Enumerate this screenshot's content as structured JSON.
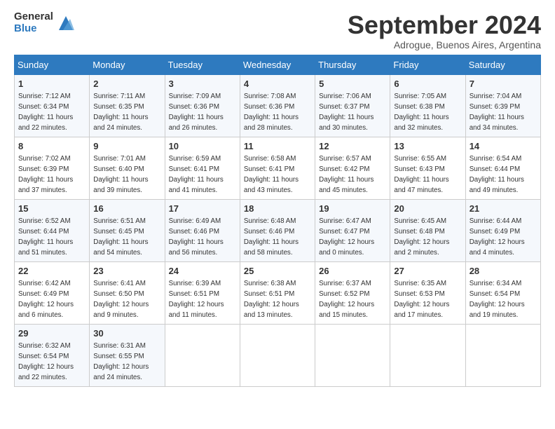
{
  "logo": {
    "general": "General",
    "blue": "Blue"
  },
  "title": "September 2024",
  "subtitle": "Adrogue, Buenos Aires, Argentina",
  "days": [
    "Sunday",
    "Monday",
    "Tuesday",
    "Wednesday",
    "Thursday",
    "Friday",
    "Saturday"
  ],
  "weeks": [
    [
      {
        "num": "1",
        "sunrise": "7:12 AM",
        "sunset": "6:34 PM",
        "daylight": "11 hours and 22 minutes."
      },
      {
        "num": "2",
        "sunrise": "7:11 AM",
        "sunset": "6:35 PM",
        "daylight": "11 hours and 24 minutes."
      },
      {
        "num": "3",
        "sunrise": "7:09 AM",
        "sunset": "6:36 PM",
        "daylight": "11 hours and 26 minutes."
      },
      {
        "num": "4",
        "sunrise": "7:08 AM",
        "sunset": "6:36 PM",
        "daylight": "11 hours and 28 minutes."
      },
      {
        "num": "5",
        "sunrise": "7:06 AM",
        "sunset": "6:37 PM",
        "daylight": "11 hours and 30 minutes."
      },
      {
        "num": "6",
        "sunrise": "7:05 AM",
        "sunset": "6:38 PM",
        "daylight": "11 hours and 32 minutes."
      },
      {
        "num": "7",
        "sunrise": "7:04 AM",
        "sunset": "6:39 PM",
        "daylight": "11 hours and 34 minutes."
      }
    ],
    [
      {
        "num": "8",
        "sunrise": "7:02 AM",
        "sunset": "6:39 PM",
        "daylight": "11 hours and 37 minutes."
      },
      {
        "num": "9",
        "sunrise": "7:01 AM",
        "sunset": "6:40 PM",
        "daylight": "11 hours and 39 minutes."
      },
      {
        "num": "10",
        "sunrise": "6:59 AM",
        "sunset": "6:41 PM",
        "daylight": "11 hours and 41 minutes."
      },
      {
        "num": "11",
        "sunrise": "6:58 AM",
        "sunset": "6:41 PM",
        "daylight": "11 hours and 43 minutes."
      },
      {
        "num": "12",
        "sunrise": "6:57 AM",
        "sunset": "6:42 PM",
        "daylight": "11 hours and 45 minutes."
      },
      {
        "num": "13",
        "sunrise": "6:55 AM",
        "sunset": "6:43 PM",
        "daylight": "11 hours and 47 minutes."
      },
      {
        "num": "14",
        "sunrise": "6:54 AM",
        "sunset": "6:44 PM",
        "daylight": "11 hours and 49 minutes."
      }
    ],
    [
      {
        "num": "15",
        "sunrise": "6:52 AM",
        "sunset": "6:44 PM",
        "daylight": "11 hours and 51 minutes."
      },
      {
        "num": "16",
        "sunrise": "6:51 AM",
        "sunset": "6:45 PM",
        "daylight": "11 hours and 54 minutes."
      },
      {
        "num": "17",
        "sunrise": "6:49 AM",
        "sunset": "6:46 PM",
        "daylight": "11 hours and 56 minutes."
      },
      {
        "num": "18",
        "sunrise": "6:48 AM",
        "sunset": "6:46 PM",
        "daylight": "11 hours and 58 minutes."
      },
      {
        "num": "19",
        "sunrise": "6:47 AM",
        "sunset": "6:47 PM",
        "daylight": "12 hours and 0 minutes."
      },
      {
        "num": "20",
        "sunrise": "6:45 AM",
        "sunset": "6:48 PM",
        "daylight": "12 hours and 2 minutes."
      },
      {
        "num": "21",
        "sunrise": "6:44 AM",
        "sunset": "6:49 PM",
        "daylight": "12 hours and 4 minutes."
      }
    ],
    [
      {
        "num": "22",
        "sunrise": "6:42 AM",
        "sunset": "6:49 PM",
        "daylight": "12 hours and 6 minutes."
      },
      {
        "num": "23",
        "sunrise": "6:41 AM",
        "sunset": "6:50 PM",
        "daylight": "12 hours and 9 minutes."
      },
      {
        "num": "24",
        "sunrise": "6:39 AM",
        "sunset": "6:51 PM",
        "daylight": "12 hours and 11 minutes."
      },
      {
        "num": "25",
        "sunrise": "6:38 AM",
        "sunset": "6:51 PM",
        "daylight": "12 hours and 13 minutes."
      },
      {
        "num": "26",
        "sunrise": "6:37 AM",
        "sunset": "6:52 PM",
        "daylight": "12 hours and 15 minutes."
      },
      {
        "num": "27",
        "sunrise": "6:35 AM",
        "sunset": "6:53 PM",
        "daylight": "12 hours and 17 minutes."
      },
      {
        "num": "28",
        "sunrise": "6:34 AM",
        "sunset": "6:54 PM",
        "daylight": "12 hours and 19 minutes."
      }
    ],
    [
      {
        "num": "29",
        "sunrise": "6:32 AM",
        "sunset": "6:54 PM",
        "daylight": "12 hours and 22 minutes."
      },
      {
        "num": "30",
        "sunrise": "6:31 AM",
        "sunset": "6:55 PM",
        "daylight": "12 hours and 24 minutes."
      },
      null,
      null,
      null,
      null,
      null
    ]
  ]
}
